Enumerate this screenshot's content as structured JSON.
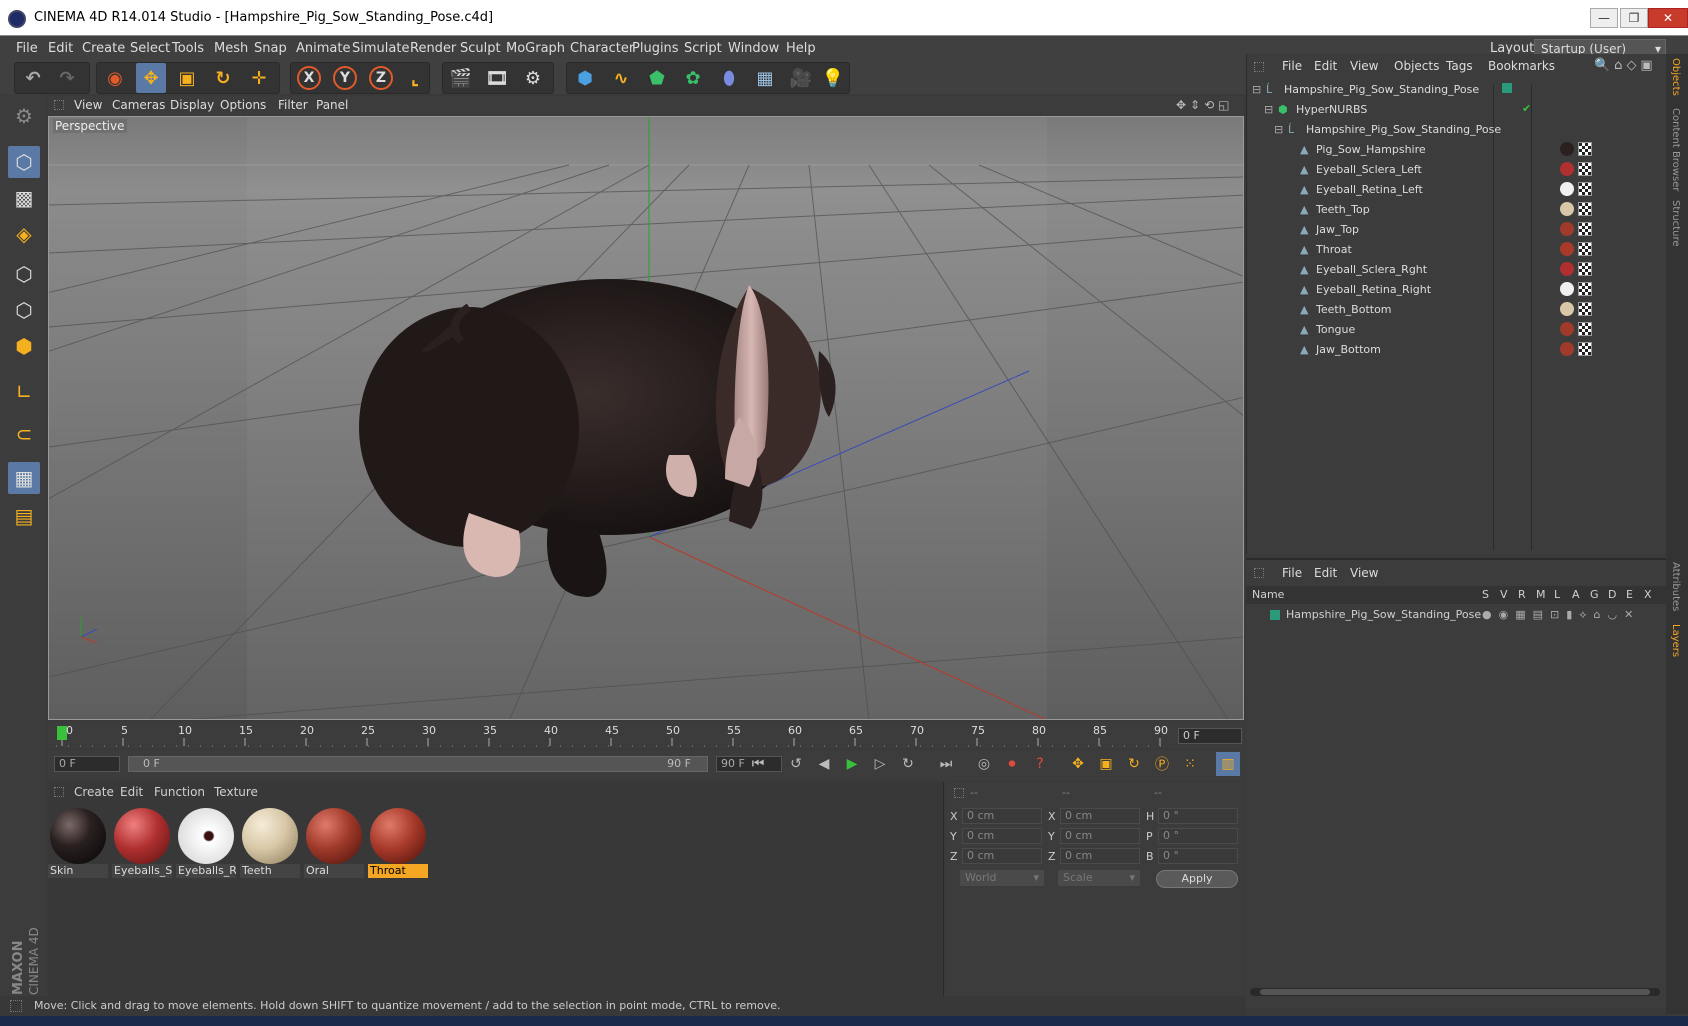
{
  "window": {
    "title": "CINEMA 4D R14.014 Studio - [Hampshire_Pig_Sow_Standing_Pose.c4d]",
    "minimize": "—",
    "maximize": "❐",
    "close": "✕"
  },
  "menubar": {
    "items": [
      "File",
      "Edit",
      "Create",
      "Select",
      "Tools",
      "Mesh",
      "Snap",
      "Animate",
      "Simulate",
      "Render",
      "Sculpt",
      "MoGraph",
      "Character",
      "Plugins",
      "Script",
      "Window",
      "Help"
    ],
    "layout_label": "Layout:",
    "layout_value": "Startup (User)"
  },
  "toolbar": {
    "x_axis": "X",
    "y_axis": "Y",
    "z_axis": "Z"
  },
  "viewport": {
    "menu": [
      "View",
      "Cameras",
      "Display",
      "Options",
      "Filter",
      "Panel"
    ],
    "label": "Perspective"
  },
  "timeline": {
    "ticks": [
      "0",
      "5",
      "10",
      "15",
      "20",
      "25",
      "30",
      "35",
      "40",
      "45",
      "50",
      "55",
      "60",
      "65",
      "70",
      "75",
      "80",
      "85",
      "90"
    ],
    "current_frame": "0 F",
    "start_field": "0 F",
    "range_start": "0 F",
    "range_end": "90 F",
    "end_field": "90 F"
  },
  "materials": {
    "menu": [
      "Create",
      "Edit",
      "Function",
      "Texture"
    ],
    "items": [
      {
        "name": "Skin",
        "color": "#2a2020"
      },
      {
        "name": "Eyeballs_Sc",
        "color": "#b03030"
      },
      {
        "name": "Eyeballs_Re",
        "color": "#f0f0f0"
      },
      {
        "name": "Teeth",
        "color": "#d8c8a8"
      },
      {
        "name": "Oral",
        "color": "#a03a2a"
      },
      {
        "name": "Throat",
        "color": "#a83a2a"
      }
    ],
    "selected": "Throat"
  },
  "coords": {
    "headers": [
      "--",
      "--",
      "--"
    ],
    "rows": [
      {
        "a": "X",
        "av": "0 cm",
        "b": "X",
        "bv": "0 cm",
        "c": "H",
        "cv": "0 °"
      },
      {
        "a": "Y",
        "av": "0 cm",
        "b": "Y",
        "bv": "0 cm",
        "c": "P",
        "cv": "0 °"
      },
      {
        "a": "Z",
        "av": "0 cm",
        "b": "Z",
        "bv": "0 cm",
        "c": "B",
        "cv": "0 °"
      }
    ],
    "mode": "World",
    "scale": "Scale",
    "apply": "Apply"
  },
  "objects": {
    "menu": [
      "File",
      "Edit",
      "View",
      "Objects",
      "Tags",
      "Bookmarks"
    ],
    "items": [
      {
        "name": "Hampshire_Pig_Sow_Standing_Pose",
        "level": 0
      },
      {
        "name": "HyperNURBS",
        "level": 1
      },
      {
        "name": "Hampshire_Pig_Sow_Standing_Pose",
        "level": 2
      },
      {
        "name": "Pig_Sow_Hampshire",
        "level": 3,
        "tag": "#2a2020"
      },
      {
        "name": "Eyeball_Sclera_Left",
        "level": 3,
        "tag": "#b03030"
      },
      {
        "name": "Eyeball_Retina_Left",
        "level": 3,
        "tag": "#f0f0f0"
      },
      {
        "name": "Teeth_Top",
        "level": 3,
        "tag": "#d8c8a8"
      },
      {
        "name": "Jaw_Top",
        "level": 3,
        "tag": "#a03a2a"
      },
      {
        "name": "Throat",
        "level": 3,
        "tag": "#a83a2a"
      },
      {
        "name": "Eyeball_Sclera_Rght",
        "level": 3,
        "tag": "#b03030"
      },
      {
        "name": "Eyeball_Retina_Right",
        "level": 3,
        "tag": "#f0f0f0"
      },
      {
        "name": "Teeth_Bottom",
        "level": 3,
        "tag": "#d8c8a8"
      },
      {
        "name": "Tongue",
        "level": 3,
        "tag": "#a03a2a"
      },
      {
        "name": "Jaw_Bottom",
        "level": 3,
        "tag": "#a03a2a"
      }
    ]
  },
  "layers": {
    "menu": [
      "File",
      "Edit",
      "View"
    ],
    "columns": [
      "Name",
      "S",
      "V",
      "R",
      "M",
      "L",
      "A",
      "G",
      "D",
      "E",
      "X"
    ],
    "rows": [
      {
        "name": "Hampshire_Pig_Sow_Standing_Pose",
        "color": "#2a9a7a"
      }
    ]
  },
  "sidetabs": [
    "Objects",
    "Content Browser",
    "Structure",
    "Attributes",
    "Layers"
  ],
  "status": "Move: Click and drag to move elements. Hold down SHIFT to quantize movement / add to the selection in point mode, CTRL to remove.",
  "brand": {
    "maker": "MAXON",
    "product": "CINEMA 4D"
  }
}
